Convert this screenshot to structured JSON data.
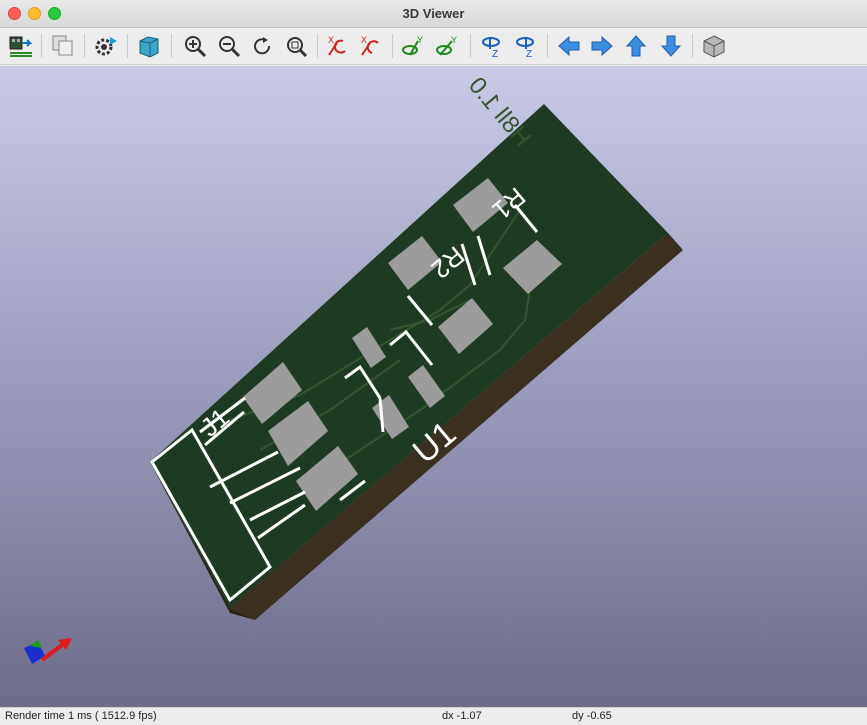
{
  "window": {
    "title": "3D Viewer"
  },
  "toolbar": {
    "buttons": [
      {
        "name": "reload-board-icon",
        "tooltip": ""
      },
      {
        "name": "copy-image-icon",
        "tooltip": ""
      },
      {
        "name": "settings-icon",
        "tooltip": ""
      },
      {
        "name": "raytrace-icon",
        "tooltip": ""
      },
      {
        "name": "zoom-in-icon",
        "tooltip": ""
      },
      {
        "name": "zoom-out-icon",
        "tooltip": ""
      },
      {
        "name": "redraw-icon",
        "tooltip": ""
      },
      {
        "name": "zoom-fit-icon",
        "tooltip": ""
      },
      {
        "name": "rotate-x-cw-icon",
        "tooltip": ""
      },
      {
        "name": "rotate-x-ccw-icon",
        "tooltip": ""
      },
      {
        "name": "rotate-y-cw-icon",
        "tooltip": ""
      },
      {
        "name": "rotate-y-ccw-icon",
        "tooltip": ""
      },
      {
        "name": "rotate-z-cw-icon",
        "tooltip": ""
      },
      {
        "name": "rotate-z-ccw-icon",
        "tooltip": ""
      },
      {
        "name": "move-left-icon",
        "tooltip": ""
      },
      {
        "name": "move-right-icon",
        "tooltip": ""
      },
      {
        "name": "move-up-icon",
        "tooltip": ""
      },
      {
        "name": "move-down-icon",
        "tooltip": ""
      },
      {
        "name": "ortho-view-icon",
        "tooltip": ""
      }
    ],
    "axis_labels": {
      "x": "X",
      "y": "Y",
      "z": "Z"
    }
  },
  "board": {
    "labels": {
      "j1": "J1",
      "u1": "U1",
      "r1": "R1",
      "r2": "R2",
      "version": "H8ll 1.0"
    },
    "colors": {
      "mask": "#1f3a23",
      "edge": "#3b3020",
      "pad": "#9c9c9c",
      "silk": "#ffffff",
      "trace": "#34552e"
    }
  },
  "status": {
    "render_time": "Render time 1 ms ( 1512.9 fps)",
    "dx": "dx -1.07",
    "dy": "dy -0.65"
  }
}
